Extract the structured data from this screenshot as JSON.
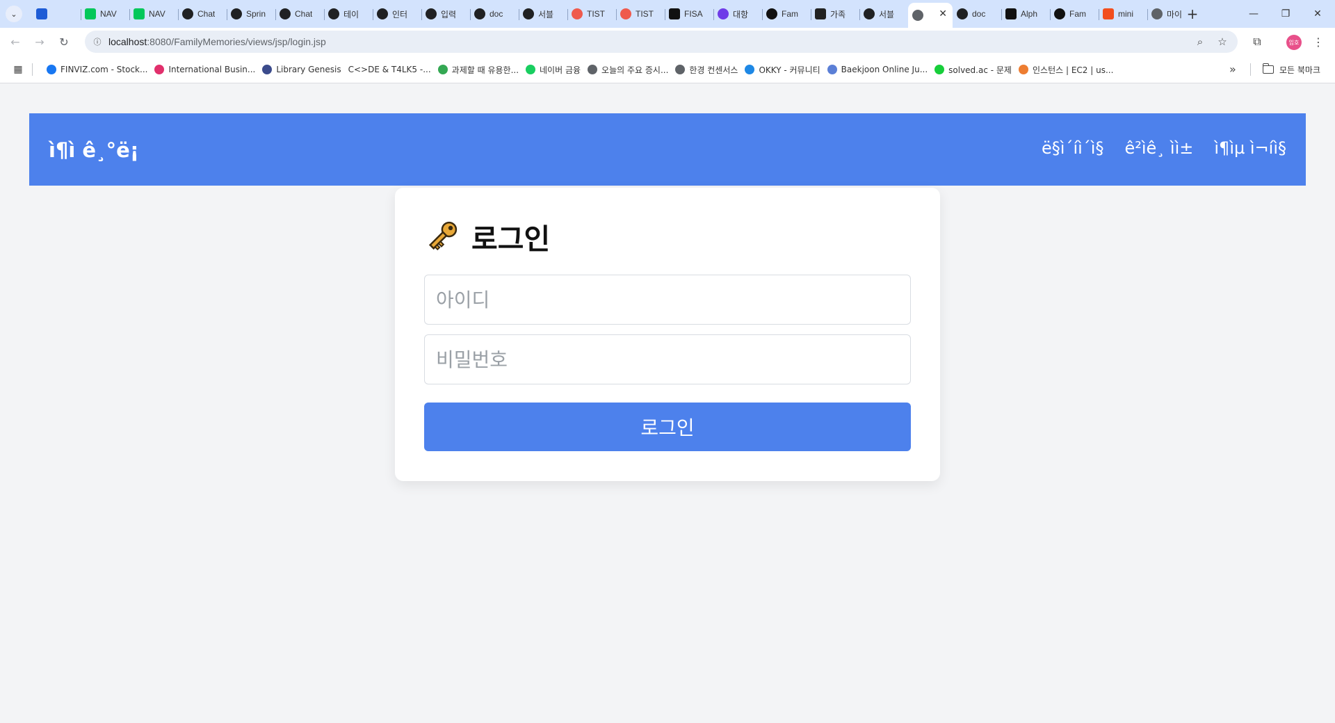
{
  "browser": {
    "tabs": [
      {
        "label": "",
        "icon": "vivaldi-icon",
        "color": "#1e5cd6"
      },
      {
        "label": "NAV",
        "icon": "naver-icon",
        "color": "#03c75a"
      },
      {
        "label": "NAV",
        "icon": "naver-icon",
        "color": "#03c75a"
      },
      {
        "label": "Chat",
        "icon": "openai-icon",
        "color": "#202123"
      },
      {
        "label": "Sprin",
        "icon": "openai-icon",
        "color": "#202123"
      },
      {
        "label": "Chat",
        "icon": "openai-icon",
        "color": "#202123"
      },
      {
        "label": "테이",
        "icon": "openai-icon",
        "color": "#202123"
      },
      {
        "label": "인터",
        "icon": "openai-icon",
        "color": "#202123"
      },
      {
        "label": "입력",
        "icon": "openai-icon",
        "color": "#202123"
      },
      {
        "label": "doc",
        "icon": "openai-icon",
        "color": "#202123"
      },
      {
        "label": "서블",
        "icon": "openai-icon",
        "color": "#202123"
      },
      {
        "label": "TIST",
        "icon": "tistory-icon",
        "color": "#ef5a4d"
      },
      {
        "label": "TIST",
        "icon": "tistory-icon",
        "color": "#ef5a4d"
      },
      {
        "label": "FISA",
        "icon": "notion-icon",
        "color": "#111111"
      },
      {
        "label": "대항",
        "icon": "purple-app-icon",
        "color": "#6f3ce8"
      },
      {
        "label": "Fam",
        "icon": "github-icon",
        "color": "#111111"
      },
      {
        "label": "가족",
        "icon": "image-app-icon",
        "color": "#222222"
      },
      {
        "label": "서블",
        "icon": "openai-icon",
        "color": "#202123"
      },
      {
        "label": "",
        "icon": "globe-icon",
        "color": "#5f6368",
        "active": true
      },
      {
        "label": "doc",
        "icon": "openai-icon",
        "color": "#202123"
      },
      {
        "label": "Alph",
        "icon": "notion-icon",
        "color": "#111111"
      },
      {
        "label": "Fam",
        "icon": "github-icon",
        "color": "#111111"
      },
      {
        "label": "mini",
        "icon": "figma-icon",
        "color": "#f24e1e"
      },
      {
        "label": "마이",
        "icon": "globe-icon",
        "color": "#5f6368"
      }
    ],
    "url_host": "localhost",
    "url_path": ":8080/FamilyMemories/views/jsp/login.jsp",
    "bookmarks": [
      {
        "label": "FINVIZ.com - Stock...",
        "icon": "facebook-icon",
        "color": "#1877f2"
      },
      {
        "label": "International Busin...",
        "icon": "nbc-icon",
        "color": "#e1306c"
      },
      {
        "label": "Library Genesis",
        "icon": "library-icon",
        "color": "#3b4b8c"
      },
      {
        "label": "C<>DE & T4LK5 -...",
        "icon": "",
        "color": ""
      },
      {
        "label": "과제할 때 유용한...",
        "icon": "bulb-icon",
        "color": "#34a853"
      },
      {
        "label": "네이버 금융",
        "icon": "pay-icon",
        "color": "#19ce60"
      },
      {
        "label": "오늘의 주요 증시...",
        "icon": "globe-icon",
        "color": "#5f6368"
      },
      {
        "label": "한경 컨센서스",
        "icon": "globe-icon",
        "color": "#5f6368"
      },
      {
        "label": "OKKY - 커뮤니티",
        "icon": "okky-icon",
        "color": "#1e88e5"
      },
      {
        "label": "Baekjoon Online Ju...",
        "icon": "code-icon",
        "color": "#5b7fd6"
      },
      {
        "label": "solved.ac - 문제",
        "icon": "solvedac-icon",
        "color": "#17ce3a"
      },
      {
        "label": "인스턴스 | EC2 | us...",
        "icon": "aws-icon",
        "color": "#ed7d31"
      }
    ],
    "all_bookmarks": "모든 북마크",
    "profile_text": "임호"
  },
  "site": {
    "brand": "ì¶ì ê¸°ë¡",
    "nav": [
      "ë§ì´íì´ì§",
      "ê²ìê¸ ìì±",
      "ì¶ìµ ì¬íì§"
    ]
  },
  "login": {
    "title": "로그인",
    "username_placeholder": "아이디",
    "password_placeholder": "비밀번호",
    "submit": "로그인"
  },
  "colors": {
    "accent": "#4d81ec",
    "page_bg": "#f3f4f6",
    "key": "#e8a838"
  }
}
